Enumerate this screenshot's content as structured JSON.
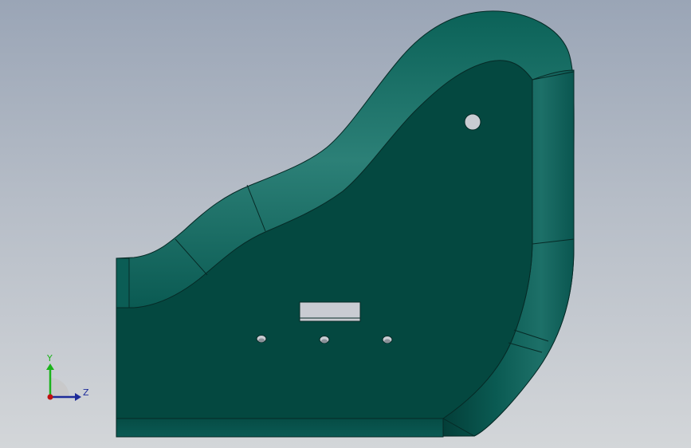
{
  "viewport": {
    "background_top": "#9aa5b6",
    "background_bottom": "#d3d6d9"
  },
  "part": {
    "face_color": "#044840",
    "edge_color": "#0a5a53",
    "highlight_color": "#2a7a72",
    "line_color": "#062a26",
    "hole_fill": "#c9ccd2"
  },
  "triad": {
    "y_label": "Y",
    "z_label": "Z",
    "y_color": "#1bb31b",
    "z_color": "#1d2b9a",
    "x_color": "#c01010"
  }
}
